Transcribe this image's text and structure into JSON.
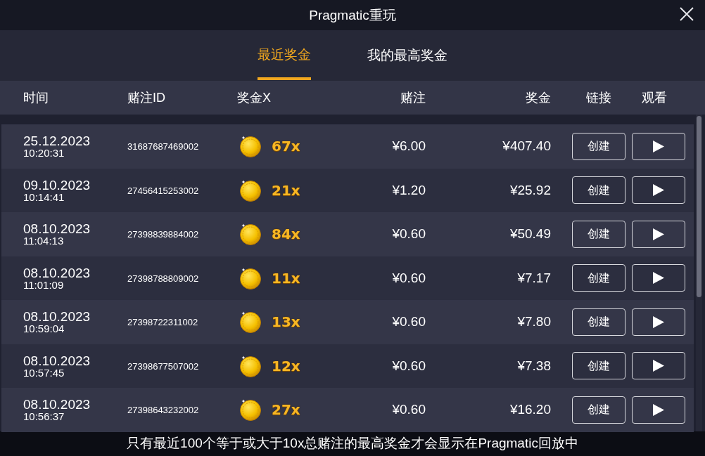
{
  "window": {
    "title": "Pragmatic重玩"
  },
  "tabs": [
    {
      "label": "最近奖金",
      "selected": true
    },
    {
      "label": "我的最高奖金",
      "selected": false
    }
  ],
  "table": {
    "columns": [
      "时间",
      "赌注ID",
      "奖金X",
      "赌注",
      "奖金",
      "链接",
      "观看"
    ],
    "rows": [
      {
        "date": "25.12.2023",
        "time": "10:20:31",
        "bet_id": "31687687469002",
        "multiplier": "67x",
        "bet": "¥6.00",
        "win": "¥407.40",
        "link_button": "创建"
      },
      {
        "date": "09.10.2023",
        "time": "10:14:41",
        "bet_id": "27456415253002",
        "multiplier": "21x",
        "bet": "¥1.20",
        "win": "¥25.92",
        "link_button": "创建"
      },
      {
        "date": "08.10.2023",
        "time": "11:04:13",
        "bet_id": "27398839884002",
        "multiplier": "84x",
        "bet": "¥0.60",
        "win": "¥50.49",
        "link_button": "创建"
      },
      {
        "date": "08.10.2023",
        "time": "11:01:09",
        "bet_id": "27398788809002",
        "multiplier": "11x",
        "bet": "¥0.60",
        "win": "¥7.17",
        "link_button": "创建"
      },
      {
        "date": "08.10.2023",
        "time": "10:59:04",
        "bet_id": "27398722311002",
        "multiplier": "13x",
        "bet": "¥0.60",
        "win": "¥7.80",
        "link_button": "创建"
      },
      {
        "date": "08.10.2023",
        "time": "10:57:45",
        "bet_id": "27398677507002",
        "multiplier": "12x",
        "bet": "¥0.60",
        "win": "¥7.38",
        "link_button": "创建"
      },
      {
        "date": "08.10.2023",
        "time": "10:56:37",
        "bet_id": "27398643232002",
        "multiplier": "27x",
        "bet": "¥0.60",
        "win": "¥16.20",
        "link_button": "创建"
      }
    ]
  },
  "footer": {
    "note": "只有最近100个等于或大于10x总赌注的最高奖金才会显示在Pragmatic回放中"
  }
}
